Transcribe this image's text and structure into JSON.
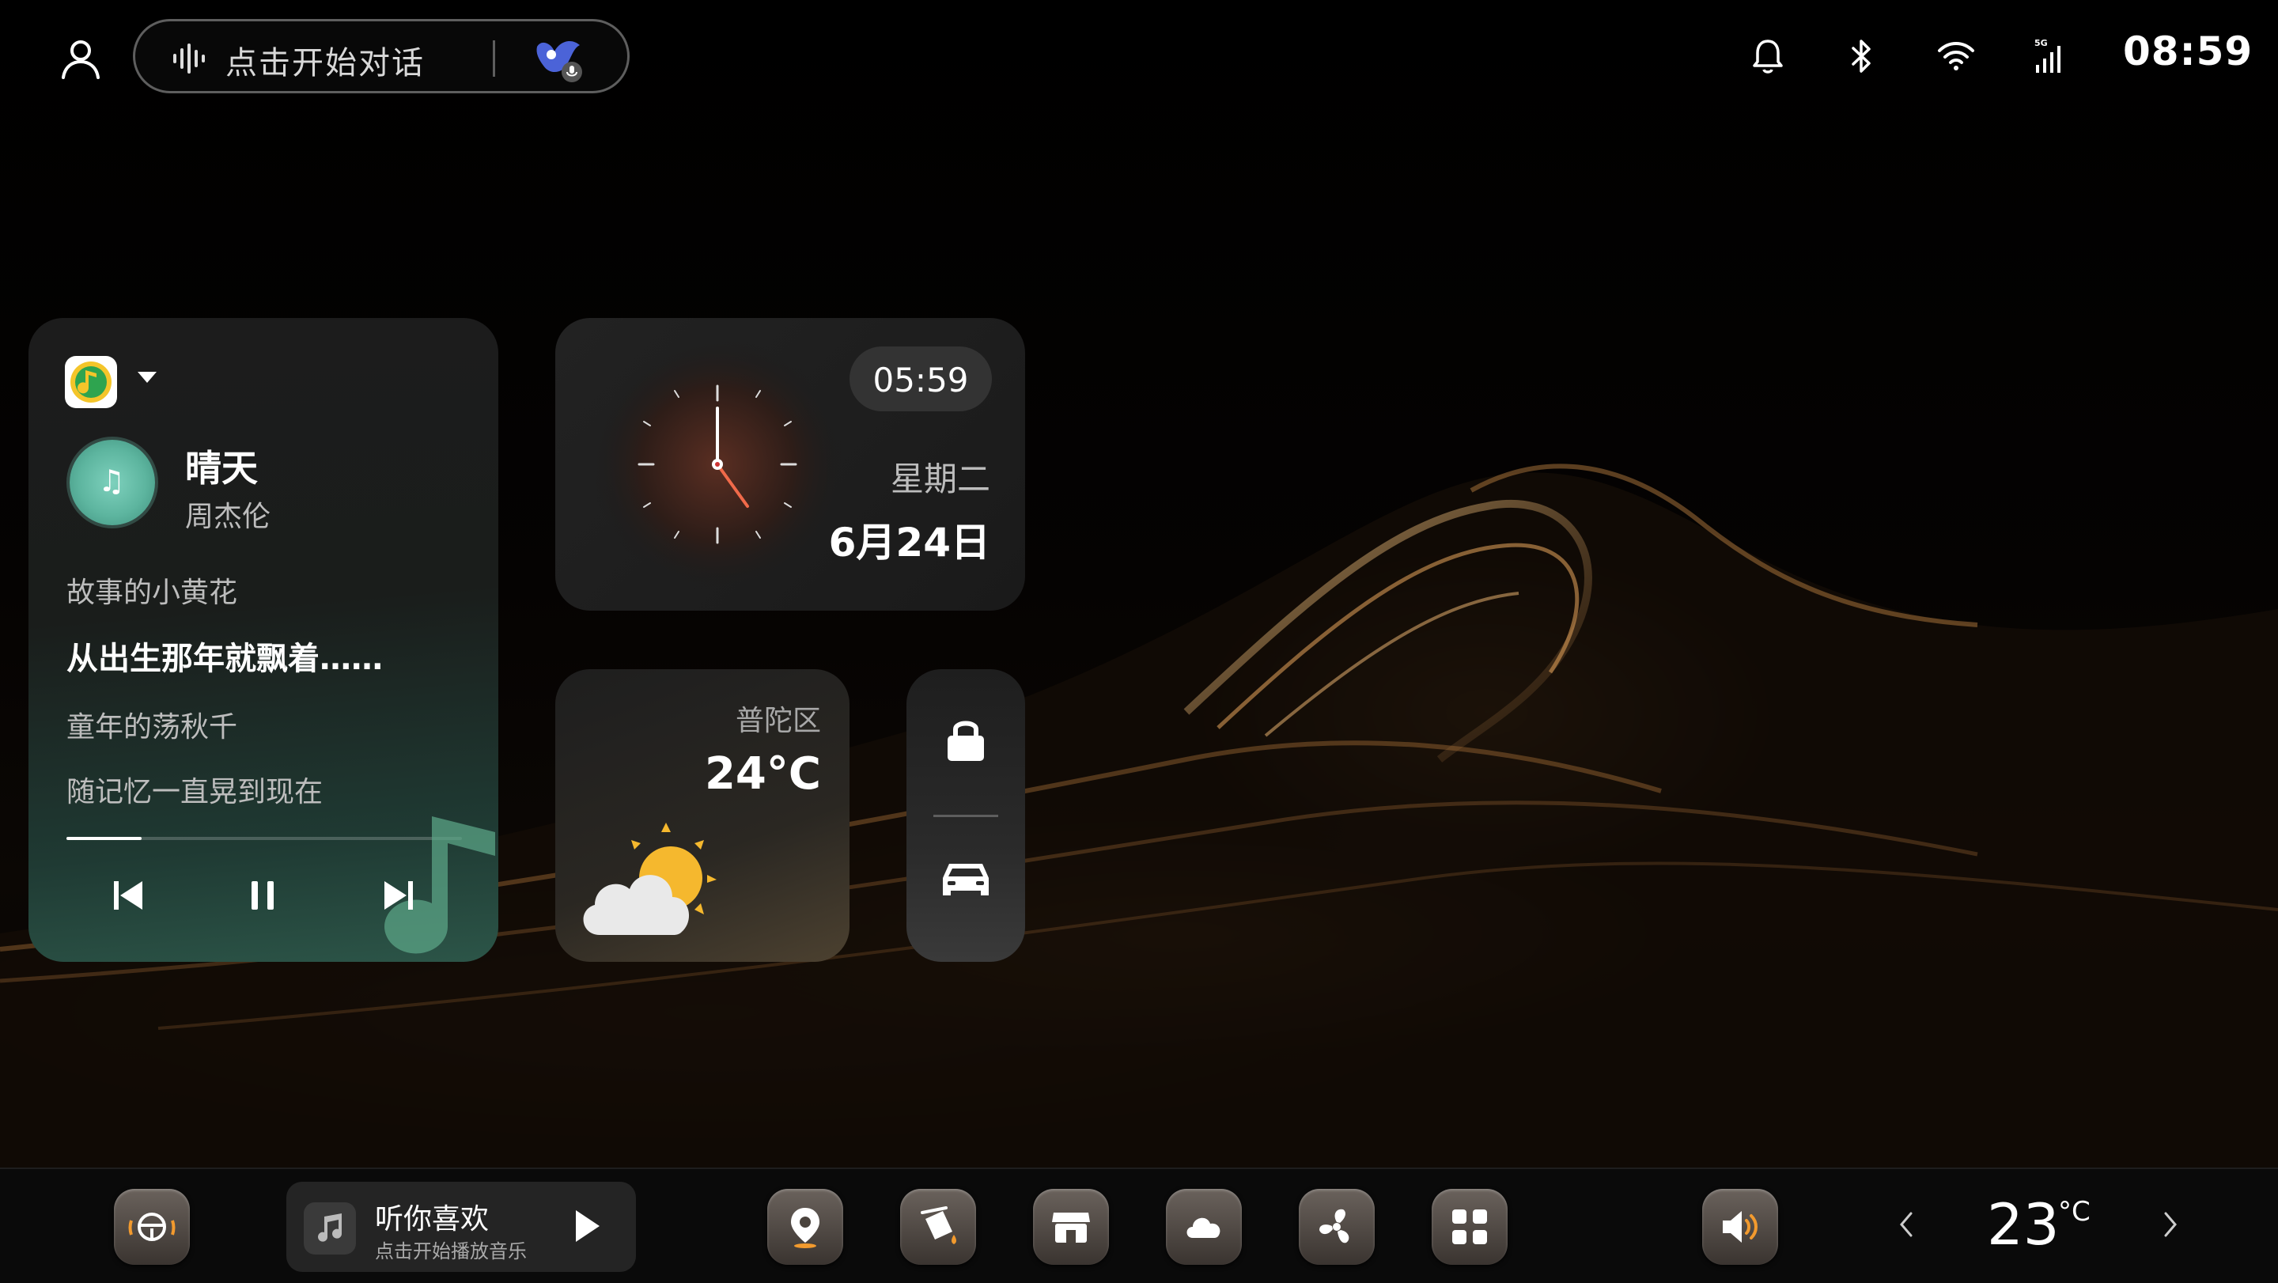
{
  "status_bar": {
    "voice_prompt": "点击开始对话",
    "time": "08:59",
    "icons": [
      "user-icon",
      "voice-wave-icon",
      "assistant-icon",
      "bell-icon",
      "bluetooth-icon",
      "wifi-icon",
      "5g-signal-icon"
    ]
  },
  "music": {
    "app_icon": "qq-music-icon",
    "title": "晴天",
    "artist": "周杰伦",
    "lyrics": [
      "故事的小黄花",
      "从出生那年就飘着……",
      "童年的荡秋千",
      "随记忆一直晃到现在"
    ],
    "current_lyric_index": 1,
    "progress_fraction": 0.19,
    "controls": [
      "previous",
      "pause",
      "next"
    ]
  },
  "clock": {
    "digital": "05:59",
    "weekday": "星期二",
    "date": "6月24日"
  },
  "weather": {
    "district": "普陀区",
    "temperature": "24°C",
    "condition_icon": "partly-cloudy-icon"
  },
  "quick": {
    "icons": [
      "lock-icon",
      "car-icon"
    ]
  },
  "dock": {
    "music_widget": {
      "title": "听你喜欢",
      "subtitle": "点击开始播放音乐"
    },
    "apps": [
      "steering-wheel-icon",
      "navigation-icon",
      "paint-bucket-icon",
      "store-icon",
      "cloud-icon",
      "fan-icon",
      "apps-grid-icon",
      "volume-icon"
    ],
    "temperature": "23",
    "temperature_unit": "°C"
  },
  "colors": {
    "accent_music": "#5db59f",
    "wave_gold": "#c88c46"
  }
}
